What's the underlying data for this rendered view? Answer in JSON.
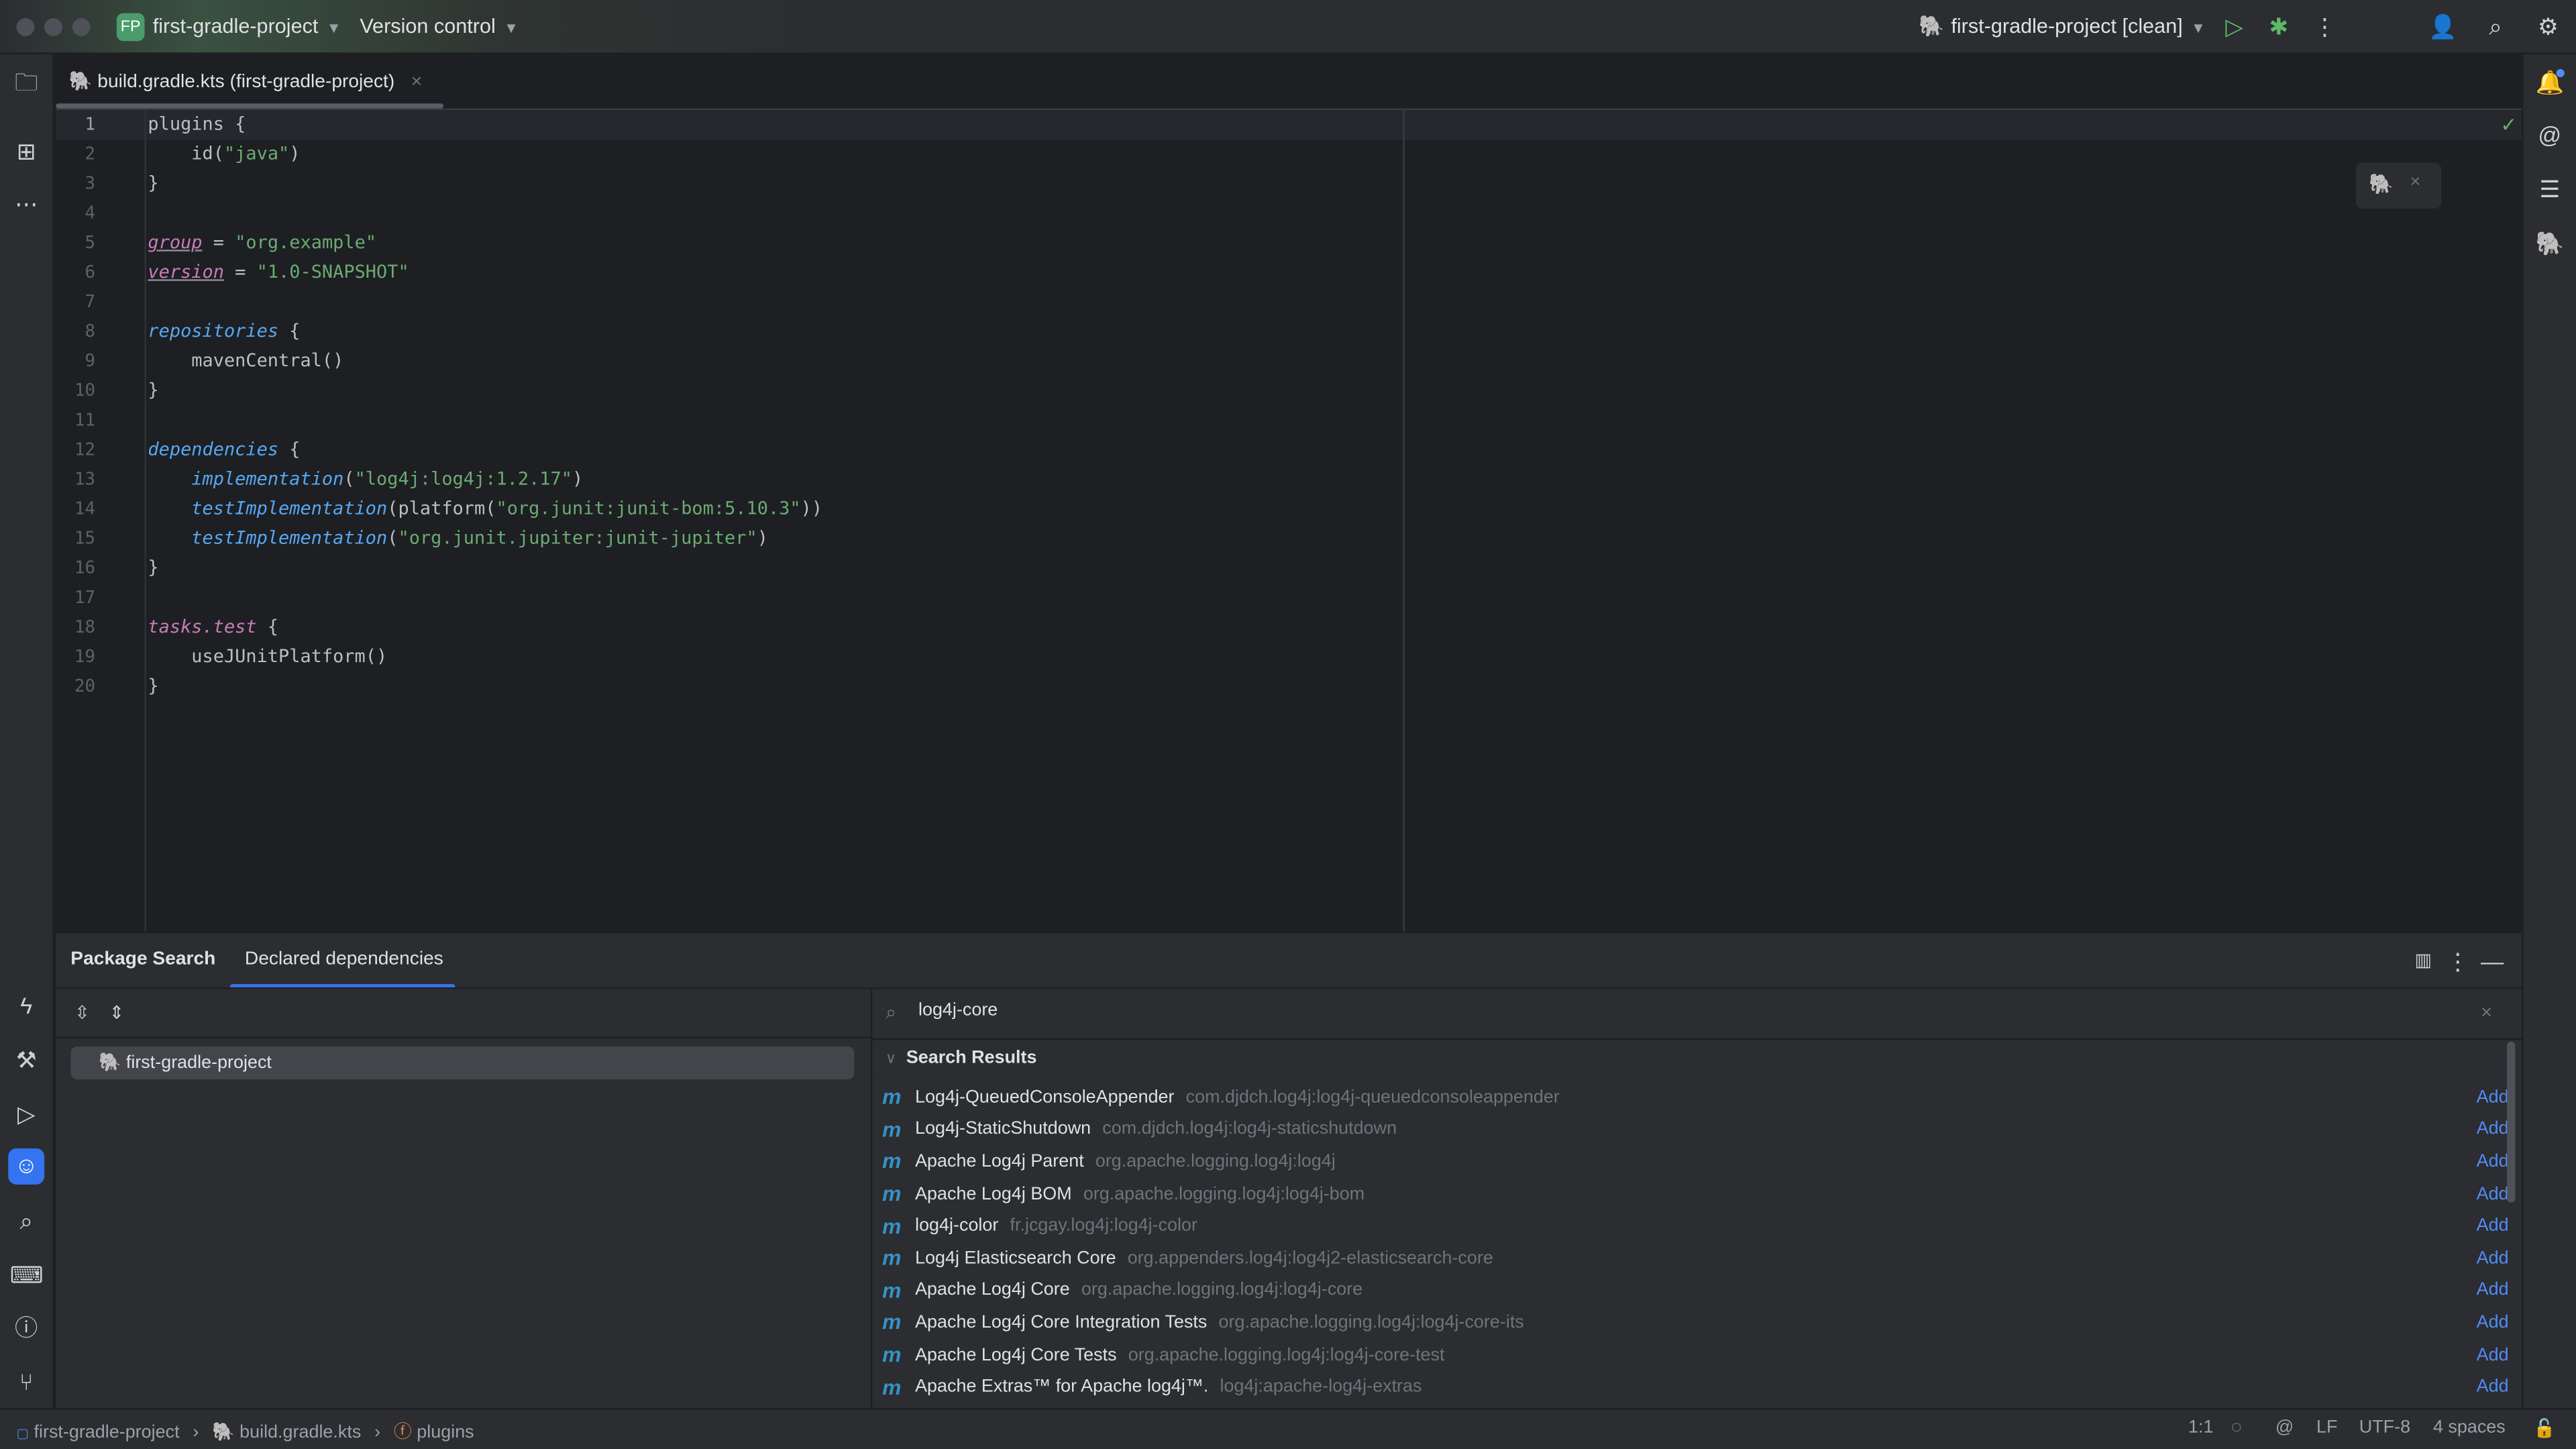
{
  "titlebar": {
    "project_badge": "FP",
    "project_name": "first-gradle-project",
    "vcs_label": "Version control",
    "run_config": "first-gradle-project [clean]"
  },
  "colors": {
    "accent": "#548af7",
    "run_green": "#5fb865",
    "badge_green": "#4a9c6a"
  },
  "tab": {
    "label": "build.gradle.kts (first-gradle-project)"
  },
  "editor": {
    "lines": [
      [
        [
          "plain",
          "plugins {"
        ]
      ],
      [
        [
          "plain",
          "    id("
        ],
        [
          "str",
          "\"java\""
        ],
        [
          "plain",
          ")"
        ]
      ],
      [
        [
          "plain",
          "}"
        ]
      ],
      [],
      [
        [
          "prop",
          "group"
        ],
        [
          "plain",
          " = "
        ],
        [
          "str",
          "\"org.example\""
        ]
      ],
      [
        [
          "prop",
          "version"
        ],
        [
          "plain",
          " = "
        ],
        [
          "str",
          "\"1.0-SNAPSHOT\""
        ]
      ],
      [],
      [
        [
          "fn",
          "repositories"
        ],
        [
          "plain",
          " {"
        ]
      ],
      [
        [
          "plain",
          "    mavenCentral()"
        ]
      ],
      [
        [
          "plain",
          "}"
        ]
      ],
      [],
      [
        [
          "fn",
          "dependencies"
        ],
        [
          "plain",
          " {"
        ]
      ],
      [
        [
          "plain",
          "    "
        ],
        [
          "fn",
          "implementation"
        ],
        [
          "plain",
          "("
        ],
        [
          "str",
          "\"log4j:log4j:1.2.17\""
        ],
        [
          "plain",
          ")"
        ]
      ],
      [
        [
          "plain",
          "    "
        ],
        [
          "fn",
          "testImplementation"
        ],
        [
          "plain",
          "(platform("
        ],
        [
          "str",
          "\"org.junit:junit-bom:5.10.3\""
        ],
        [
          "plain",
          "))"
        ]
      ],
      [
        [
          "plain",
          "    "
        ],
        [
          "fn",
          "testImplementation"
        ],
        [
          "plain",
          "("
        ],
        [
          "str",
          "\"org.junit.jupiter:junit-jupiter\""
        ],
        [
          "plain",
          ")"
        ]
      ],
      [
        [
          "plain",
          "}"
        ]
      ],
      [],
      [
        [
          "ext",
          "tasks.test"
        ],
        [
          "plain",
          " {"
        ]
      ],
      [
        [
          "plain",
          "    useJUnitPlatform()"
        ]
      ],
      [
        [
          "plain",
          "}"
        ]
      ]
    ]
  },
  "panel": {
    "tabs": [
      {
        "label": "Package Search",
        "active": false
      },
      {
        "label": "Declared dependencies",
        "active": true
      }
    ],
    "module": "first-gradle-project",
    "search_value": "log4j-core",
    "results_header": "Search Results",
    "add_label": "Add",
    "results": [
      {
        "name": "Log4j-QueuedConsoleAppender",
        "coord": "com.djdch.log4j:log4j-queuedconsoleappender"
      },
      {
        "name": "Log4j-StaticShutdown",
        "coord": "com.djdch.log4j:log4j-staticshutdown"
      },
      {
        "name": "Apache Log4j Parent",
        "coord": "org.apache.logging.log4j:log4j"
      },
      {
        "name": "Apache Log4j BOM",
        "coord": "org.apache.logging.log4j:log4j-bom"
      },
      {
        "name": "log4j-color",
        "coord": "fr.jcgay.log4j:log4j-color"
      },
      {
        "name": "Log4j Elasticsearch Core",
        "coord": "org.appenders.log4j:log4j2-elasticsearch-core"
      },
      {
        "name": "Apache Log4j Core",
        "coord": "org.apache.logging.log4j:log4j-core"
      },
      {
        "name": "Apache Log4j Core Integration Tests",
        "coord": "org.apache.logging.log4j:log4j-core-its"
      },
      {
        "name": "Apache Log4j Core Tests",
        "coord": "org.apache.logging.log4j:log4j-core-test"
      },
      {
        "name": "Apache Extras™ for Apache log4j™.",
        "coord": "log4j:apache-log4j-extras"
      }
    ]
  },
  "status": {
    "crumbs": [
      "first-gradle-project",
      "build.gradle.kts",
      "plugins"
    ],
    "position": "1:1",
    "line_sep": "LF",
    "encoding": "UTF-8",
    "indent": "4 spaces"
  }
}
